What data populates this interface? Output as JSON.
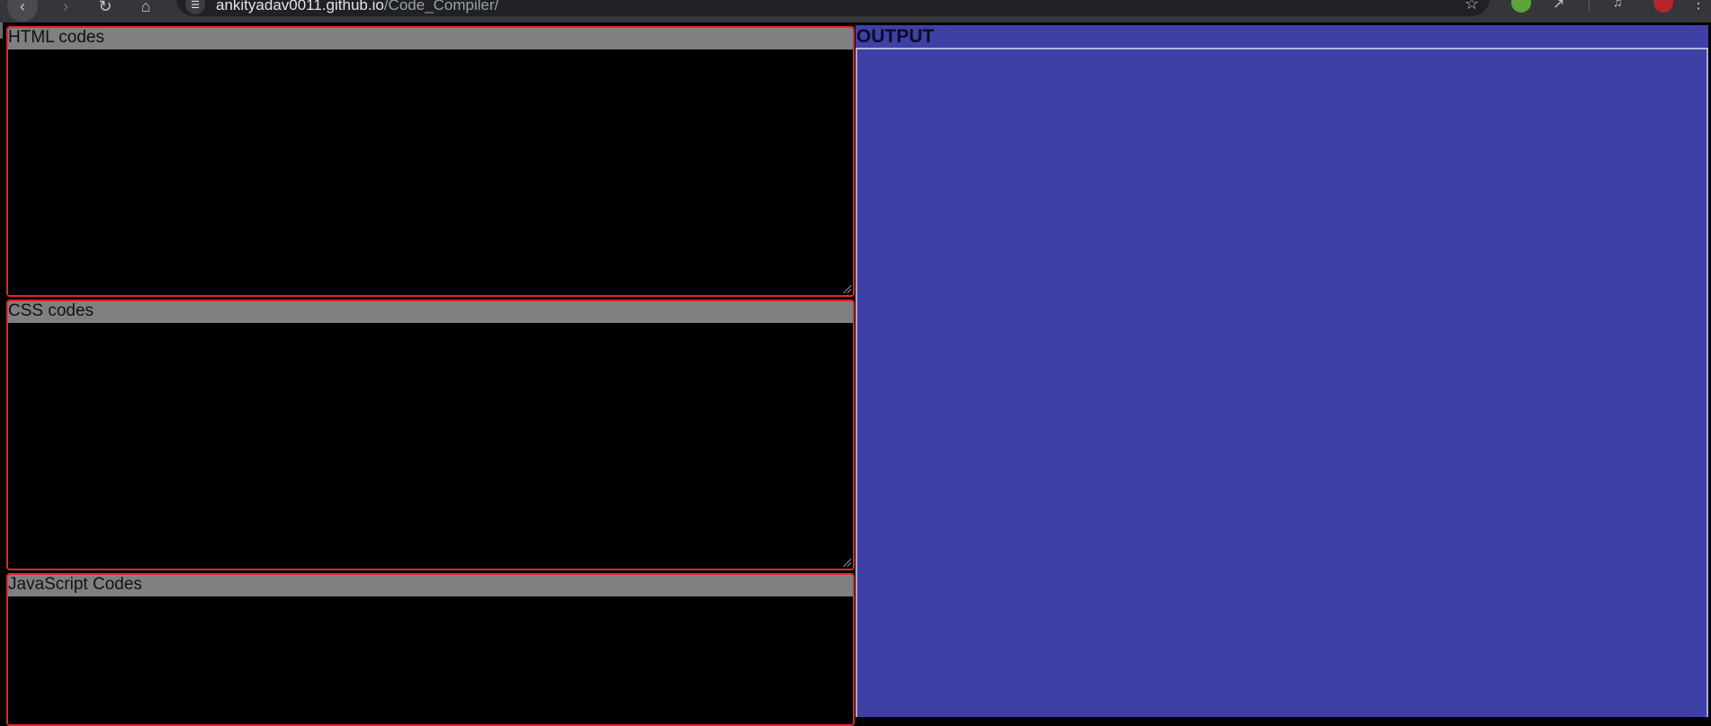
{
  "browser": {
    "url_host": "ankityadav0011.github.io",
    "url_path": "/Code_Compiler/",
    "back_icon": "arrow-left",
    "forward_icon": "arrow-right",
    "reload_icon": "reload",
    "home_icon": "home",
    "siteinfo_icon": "tune",
    "bookmark_icon": "star"
  },
  "editors": [
    {
      "label": "HTML codes",
      "value": ""
    },
    {
      "label": "CSS codes",
      "value": ""
    },
    {
      "label": "JavaScript Codes",
      "value": ""
    }
  ],
  "output": {
    "title": "OUTPUT"
  },
  "colors": {
    "editor_border": "#e3262b",
    "editor_label_bg": "#808080",
    "editor_bg": "#000000",
    "output_bg": "#3f40a6"
  }
}
